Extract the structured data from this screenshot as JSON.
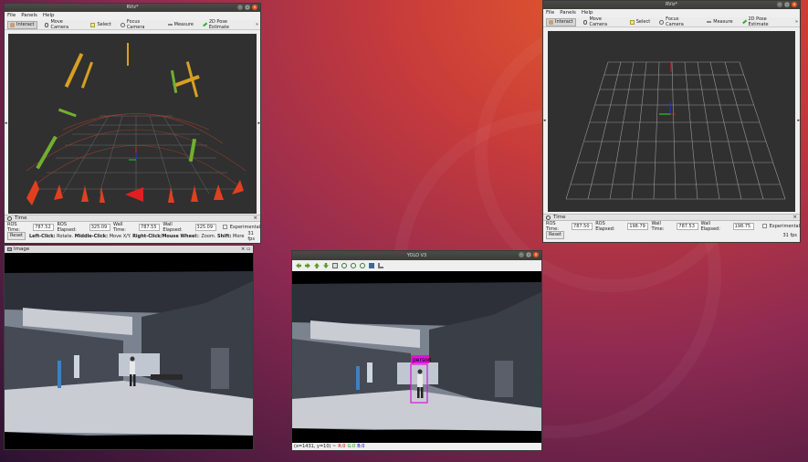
{
  "rviz_left": {
    "title": "RViz*",
    "menus": [
      "File",
      "Panels",
      "Help"
    ],
    "tools": [
      "Interact",
      "Move Camera",
      "Select",
      "Focus Camera",
      "Measure",
      "2D Pose Estimate"
    ],
    "time_panel_title": "Time",
    "ros_time_label": "ROS Time:",
    "ros_time": "787.52",
    "ros_elapsed_label": "ROS Elapsed:",
    "ros_elapsed": "325.09",
    "wall_time_label": "Wall Time:",
    "wall_time": "787.55",
    "wall_elapsed_label": "Wall Elapsed:",
    "wall_elapsed": "325.09",
    "experimental_label": "Experimental",
    "reset_label": "Reset",
    "hint_bold1": "Left-Click:",
    "hint_text1": " Rotate. ",
    "hint_bold2": "Middle-Click:",
    "hint_text2": " Move X/Y. ",
    "hint_bold3": "Right-Click/Mouse Wheel:",
    "hint_text3": ": Zoom. ",
    "hint_bold4": "Shift:",
    "hint_text4": " More",
    "fps": "31 fps"
  },
  "rviz_right": {
    "title": "RViz*",
    "menus": [
      "File",
      "Panels",
      "Help"
    ],
    "tools": [
      "Interact",
      "Move Camera",
      "Select",
      "Focus Camera",
      "Measure",
      "2D Pose Estimate"
    ],
    "time_panel_title": "Time",
    "ros_time_label": "ROS Time:",
    "ros_time": "787.50",
    "ros_elapsed_label": "ROS Elapsed:",
    "ros_elapsed": "198.79",
    "wall_time_label": "Wall Time:",
    "wall_time": "787.53",
    "wall_elapsed_label": "Wall Elapsed:",
    "wall_elapsed": "198.75",
    "experimental_label": "Experimental",
    "reset_label": "Reset",
    "fps": "31 fps"
  },
  "image_window": {
    "title": "Image"
  },
  "yolo_window": {
    "title": "YOLO V3",
    "detection_label": "person",
    "status_coords": "(x=1431, y=10) ~",
    "status_r": "R:0",
    "status_g": "G:0",
    "status_b": "B:0"
  },
  "colors": {
    "accent": "#e95420",
    "detection_box": "#d816d8"
  }
}
